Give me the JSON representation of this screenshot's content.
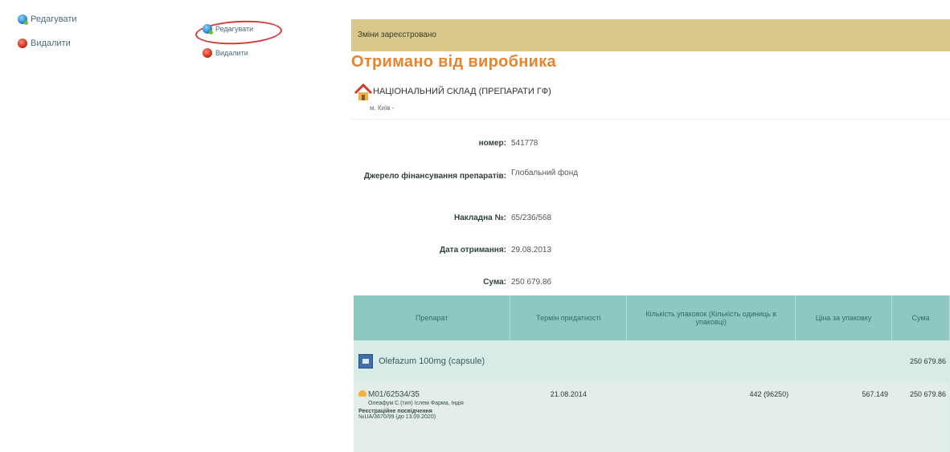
{
  "actions_a": {
    "edit": "Редагувати",
    "delete": "Видалити"
  },
  "actions_b": {
    "edit": "Редагувати",
    "delete": "Видалити"
  },
  "notice": "Зміни зареєстровано",
  "title": "Отримано від виробника",
  "warehouse": {
    "name": "НАЦІОНАЛЬНИЙ СКЛАД (ПРЕПАРАТИ ГФ)",
    "city": "м. Київ -"
  },
  "fields": [
    {
      "label": "номер:",
      "value": "541778"
    },
    {
      "label": "Джерело фінансування препаратів:",
      "value": "Глобальний фонд"
    },
    {
      "label": "Накладна №:",
      "value": "65/236/568"
    },
    {
      "label": "Дата отримання:",
      "value": "29.08.2013"
    },
    {
      "label": "Сума:",
      "value": "250 679.86"
    }
  ],
  "table": {
    "headers": [
      "Препарат",
      "Термін придатності",
      "Кількість упаковок (Кількість одиниць в упаковці)",
      "Ціна за упаковку",
      "Сума"
    ],
    "group_row": {
      "drug": "Olefazum 100mg (capsule)",
      "sum": "250 679.86"
    },
    "detail_row": {
      "series": "M01/62534/35",
      "maker": "Олеафум С (тип) Іслем Фарма, Індія",
      "reg_label": "Реєстраційне посвідчення",
      "reg_value": "№UA/3670/99 (до 13.09.2020)",
      "expiry": "21.08.2014",
      "qty": "442 (96250)",
      "price": "567.149",
      "sum": "250 679.86"
    }
  },
  "colors": {
    "title": "#e8842e",
    "notice_bg": "#d9c88c",
    "header_bg": "#8ec9c1",
    "highlight": "#d23b3b"
  }
}
